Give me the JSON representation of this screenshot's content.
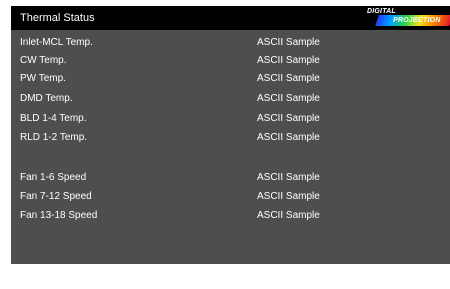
{
  "header": {
    "title": "Thermal Status",
    "logo": {
      "line1": "DIGITAL",
      "line2": "PROJECTION"
    }
  },
  "temperature_rows": [
    {
      "label": "Inlet-MCL Temp.",
      "value": "ASCII Sample"
    },
    {
      "label": "CW Temp.",
      "value": "ASCII Sample"
    },
    {
      "label": "PW Temp.",
      "value": "ASCII Sample"
    },
    {
      "label": "DMD Temp.",
      "value": "ASCII Sample"
    },
    {
      "label": "BLD 1-4 Temp.",
      "value": "ASCII Sample"
    },
    {
      "label": "RLD  1-2 Temp.",
      "value": "ASCII Sample"
    }
  ],
  "fan_rows": [
    {
      "label": "Fan 1-6 Speed",
      "value": "ASCII Sample"
    },
    {
      "label": "Fan 7-12 Speed",
      "value": "ASCII Sample"
    },
    {
      "label": "Fan 13-18 Speed",
      "value": "ASCII Sample"
    }
  ]
}
